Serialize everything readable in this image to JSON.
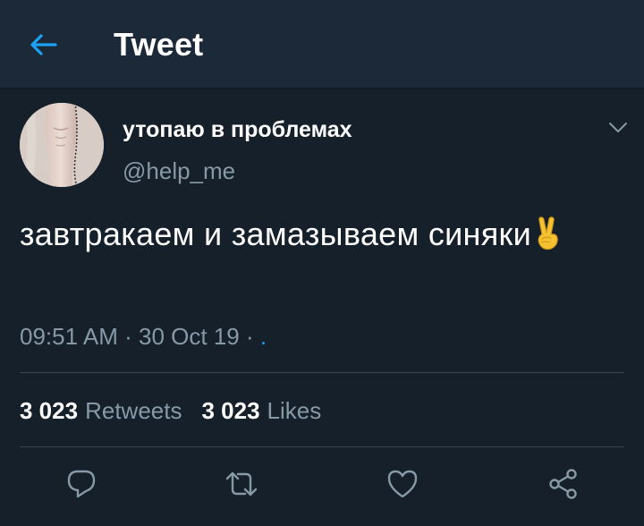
{
  "header": {
    "title": "Tweet",
    "back_icon": "arrow-left-icon"
  },
  "tweet": {
    "author_name": "утопаю в проблемах",
    "handle": "@help_me",
    "text": "завтракаем и замазываем синяки",
    "emoji": "victory-hand-emoji",
    "time": "09:51 AM",
    "date": "30 Oct 19",
    "separator": "·",
    "source": "."
  },
  "stats": {
    "retweets_count": "3 023",
    "retweets_label": "Retweets",
    "likes_count": "3 023",
    "likes_label": "Likes"
  },
  "actions": {
    "reply_icon": "reply-icon",
    "retweet_icon": "retweet-icon",
    "like_icon": "heart-icon",
    "share_icon": "share-icon"
  },
  "colors": {
    "background": "#15202b",
    "header_background": "#1c2938",
    "accent": "#1da1f2",
    "secondary_text": "#8899a6",
    "divider": "#38444d"
  }
}
